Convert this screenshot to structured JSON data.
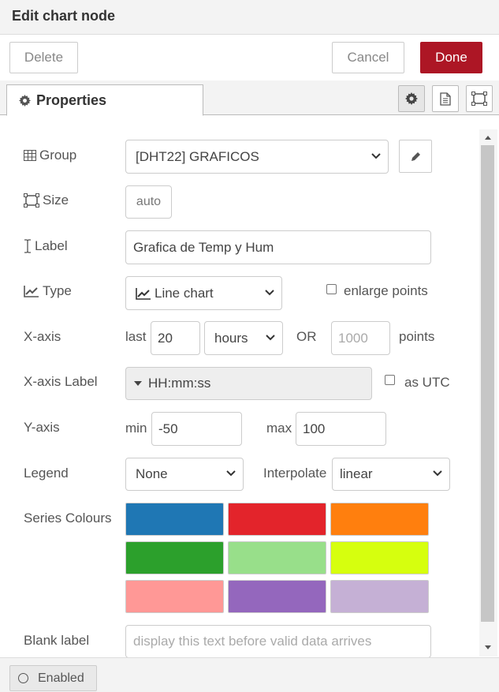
{
  "header": {
    "title": "Edit chart node"
  },
  "toolbar": {
    "delete_label": "Delete",
    "cancel_label": "Cancel",
    "done_label": "Done"
  },
  "tabs": {
    "properties_label": "Properties",
    "icons": [
      "gear-icon",
      "document-icon",
      "frame-icon"
    ]
  },
  "form": {
    "group": {
      "label": "Group",
      "value": "[DHT22] GRAFICOS"
    },
    "size": {
      "label": "Size",
      "value": "auto"
    },
    "label": {
      "label": "Label",
      "value": "Grafica de Temp y Hum"
    },
    "type": {
      "label": "Type",
      "value": "Line chart",
      "enlarge_points_label": "enlarge points",
      "enlarge_points_checked": false
    },
    "xaxis": {
      "label": "X-axis",
      "last_label": "last",
      "last_value": "20",
      "unit": "hours",
      "or_label": "OR",
      "points_placeholder": "1000",
      "points_label": "points"
    },
    "xaxis_label": {
      "label": "X-axis Label",
      "value": "HH:mm:ss",
      "utc_label": "as UTC",
      "utc_checked": false
    },
    "yaxis": {
      "label": "Y-axis",
      "min_label": "min",
      "min_value": "-50",
      "max_label": "max",
      "max_value": "100"
    },
    "legend": {
      "label": "Legend",
      "value": "None",
      "interpolate_label": "Interpolate",
      "interpolate_value": "linear"
    },
    "series_colours": {
      "label": "Series Colours",
      "colors": [
        "#1f77b4",
        "#e3242b",
        "#ff7f0e",
        "#2ca02c",
        "#98df8a",
        "#d6ff0e",
        "#ff9896",
        "#9467bd",
        "#c5b0d5"
      ]
    },
    "blank": {
      "label": "Blank label",
      "placeholder": "display this text before valid data arrives"
    }
  },
  "footer": {
    "enabled_label": "Enabled"
  }
}
